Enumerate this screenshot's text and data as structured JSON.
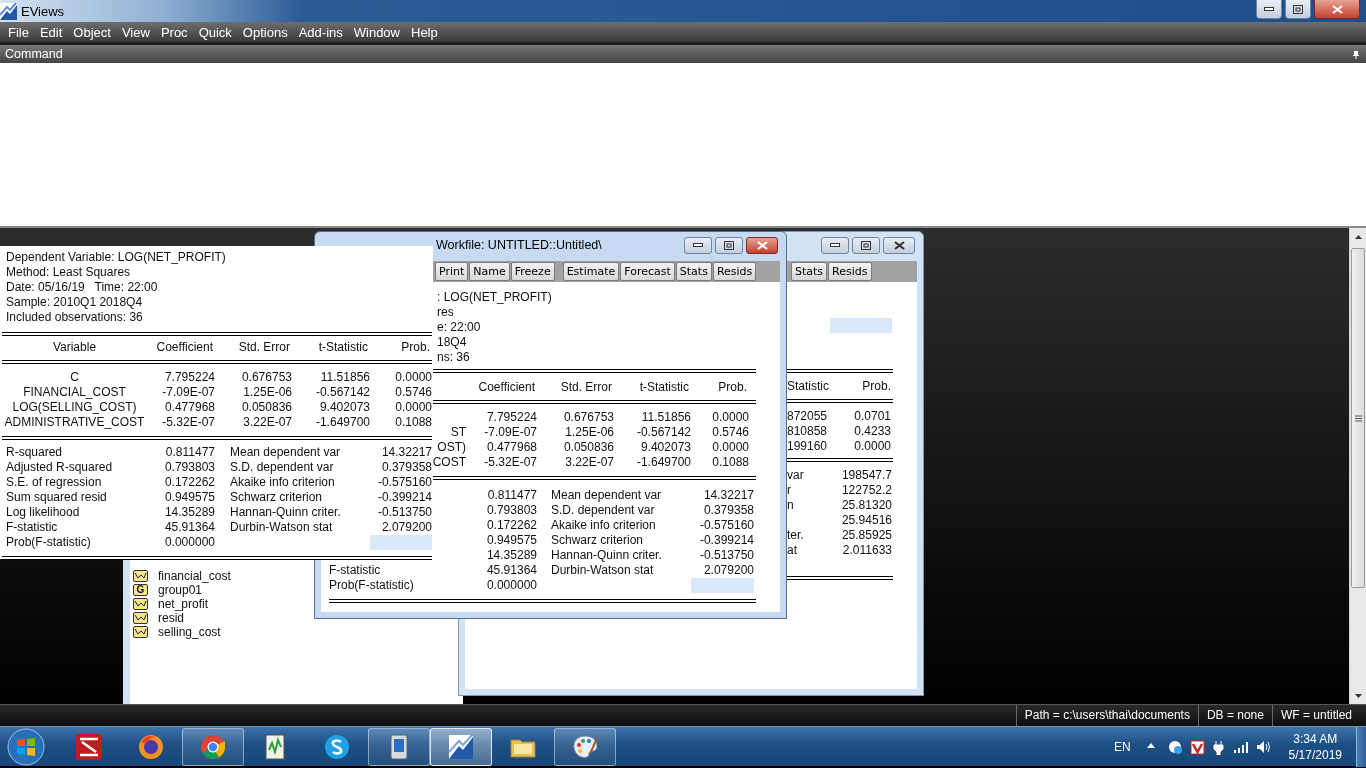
{
  "app_window": {
    "title": "EViews"
  },
  "menu": [
    "File",
    "Edit",
    "Object",
    "View",
    "Proc",
    "Quick",
    "Options",
    "Add-ins",
    "Window",
    "Help"
  ],
  "command_window": {
    "title": "Command"
  },
  "workfile_window": {
    "objects": [
      {
        "kind": "series",
        "name": "financial_cost"
      },
      {
        "kind": "group",
        "badge": "G",
        "name": "group01"
      },
      {
        "kind": "series",
        "name": "net_profit"
      },
      {
        "kind": "series",
        "name": "resid"
      },
      {
        "kind": "series",
        "name": "selling_cost"
      }
    ]
  },
  "equation_window_back": {
    "active": false,
    "toolbar": [
      "Stats",
      "Resids"
    ],
    "columns": [
      "Statistic",
      "Prob."
    ],
    "rows": [
      [
        "872055",
        "0.0701"
      ],
      [
        "810858",
        "0.4233"
      ],
      [
        "199160",
        "0.0000"
      ]
    ],
    "stats": [
      {
        "label": "var",
        "value": "198547.7"
      },
      {
        "label": "r",
        "value": "122752.2"
      },
      {
        "label": "n",
        "value": "25.81320"
      },
      {
        "value": "25.94516"
      },
      {
        "label": "ter.",
        "value": "25.85925"
      },
      {
        "label": "at",
        "value": "2.011633"
      }
    ]
  },
  "equation_window": {
    "active": true,
    "title": "Workfile: UNTITLED::Untitled\\",
    "toolbar": [
      "Print",
      "Name",
      "Freeze",
      "Estimate",
      "Forecast",
      "Stats",
      "Resids"
    ],
    "header_lines": [
      ": LOG(NET_PROFIT)",
      "res",
      "e: 22:00",
      "18Q4",
      "ns: 36"
    ],
    "columns": [
      "Coefficient",
      "Std. Error",
      "t-Statistic",
      "Prob."
    ],
    "rows": [
      {
        "values": [
          "7.795224",
          "0.676753",
          "11.51856",
          "0.0000"
        ]
      },
      {
        "variable": "ST",
        "values": [
          "-7.09E-07",
          "1.25E-06",
          "-0.567142",
          "0.5746"
        ]
      },
      {
        "variable": "OST)",
        "values": [
          "0.477968",
          "0.050836",
          "9.402073",
          "0.0000"
        ]
      },
      {
        "variable": "COST",
        "values": [
          "-5.32E-07",
          "3.22E-07",
          "-1.649700",
          "0.1088"
        ]
      }
    ],
    "stats": [
      {
        "value": "0.811477",
        "label2": "Mean dependent var",
        "value2": "14.32217"
      },
      {
        "value": "0.793803",
        "label2": "S.D. dependent var",
        "value2": "0.379358"
      },
      {
        "value": "0.172262",
        "label2": "Akaike info criterion",
        "value2": "-0.575160"
      },
      {
        "value": "0.949575",
        "label2": "Schwarz criterion",
        "value2": "-0.399214"
      },
      {
        "value": "14.35289",
        "label2": "Hannan-Quinn criter.",
        "value2": "-0.513750"
      },
      {
        "label": "F-statistic",
        "value": "45.91364",
        "label2": "Durbin-Watson stat",
        "value2": "2.079200"
      },
      {
        "label": "Prob(F-statistic)",
        "value": "0.000000"
      }
    ]
  },
  "frozen_output": {
    "header_lines": [
      "Dependent Variable: LOG(NET_PROFIT)",
      "Method: Least Squares",
      "Date: 05/16/19   Time: 22:00",
      "Sample: 2010Q1 2018Q4",
      "Included observations: 36"
    ],
    "columns": [
      "Variable",
      "Coefficient",
      "Std. Error",
      "t-Statistic",
      "Prob."
    ],
    "rows": [
      {
        "variable": "C",
        "values": [
          "7.795224",
          "0.676753",
          "11.51856",
          "0.0000"
        ]
      },
      {
        "variable": "FINANCIAL_COST",
        "values": [
          "-7.09E-07",
          "1.25E-06",
          "-0.567142",
          "0.5746"
        ]
      },
      {
        "variable": "LOG(SELLING_COST)",
        "values": [
          "0.477968",
          "0.050836",
          "9.402073",
          "0.0000"
        ]
      },
      {
        "variable": "ADMINISTRATIVE_COST",
        "values": [
          "-5.32E-07",
          "3.22E-07",
          "-1.649700",
          "0.1088"
        ]
      }
    ],
    "stats": [
      {
        "label": "R-squared",
        "value": "0.811477",
        "label2": "Mean dependent var",
        "value2": "14.32217"
      },
      {
        "label": "Adjusted R-squared",
        "value": "0.793803",
        "label2": "S.D. dependent var",
        "value2": "0.379358"
      },
      {
        "label": "S.E. of regression",
        "value": "0.172262",
        "label2": "Akaike info criterion",
        "value2": "-0.575160"
      },
      {
        "label": "Sum squared resid",
        "value": "0.949575",
        "label2": "Schwarz criterion",
        "value2": "-0.399214"
      },
      {
        "label": "Log likelihood",
        "value": "14.35289",
        "label2": "Hannan-Quinn criter.",
        "value2": "-0.513750"
      },
      {
        "label": "F-statistic",
        "value": "45.91364",
        "label2": "Durbin-Watson stat",
        "value2": "2.079200"
      },
      {
        "label": "Prob(F-statistic)",
        "value": "0.000000"
      }
    ]
  },
  "status_bar": [
    "Path = c:\\users\\thai\\documents",
    "DB = none",
    "WF = untitled"
  ],
  "taskbar": {
    "apps": [
      {
        "kind": "filezilla",
        "running": false,
        "selected": false
      },
      {
        "kind": "firefox",
        "running": false,
        "selected": false
      },
      {
        "kind": "chrome",
        "running": true,
        "selected": false
      },
      {
        "kind": "editor",
        "running": false,
        "selected": false
      },
      {
        "kind": "skype",
        "running": false,
        "selected": false
      },
      {
        "kind": "computer",
        "running": true,
        "selected": false
      },
      {
        "kind": "eviews",
        "running": true,
        "selected": true
      },
      {
        "kind": "explorer",
        "running": false,
        "selected": false
      },
      {
        "kind": "paint",
        "running": true,
        "selected": false
      }
    ],
    "language": "EN",
    "time": "3:34 AM",
    "date": "5/17/2019"
  }
}
